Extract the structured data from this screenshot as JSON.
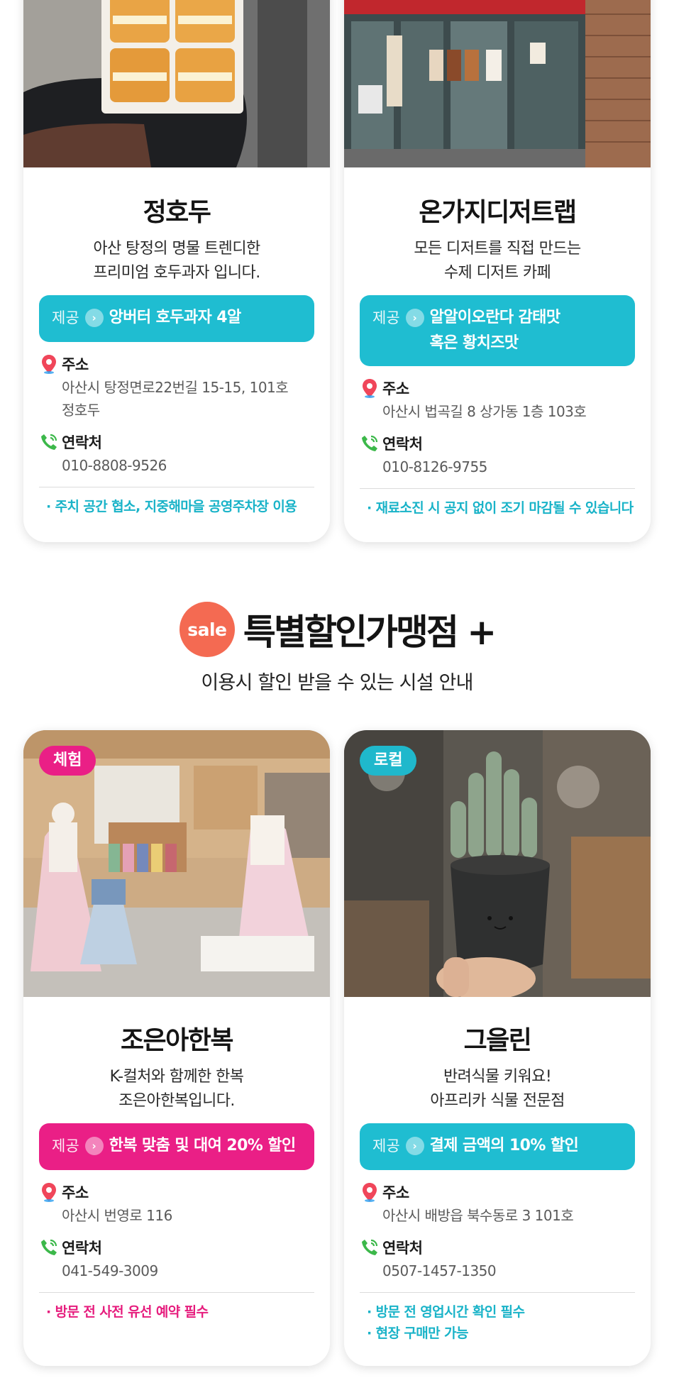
{
  "cards_top": [
    {
      "name": "정호두",
      "desc": [
        "아산 탕정의 명물 트렌디한",
        "프리미엄 호두과자 입니다."
      ],
      "benefit_label": "제공",
      "benefit": [
        "앙버터 호두과자 4알"
      ],
      "address_label": "주소",
      "address": [
        "아산시 탕정면로22번길 15-15, 101호",
        "정호두"
      ],
      "contact_label": "연락처",
      "phone": "010-8808-9526",
      "notes": [
        "· 주치 공간 협소, 지중해마을 공영주차장 이용"
      ]
    },
    {
      "name": "온가지디저트랩",
      "desc": [
        "모든 디저트를 직접 만드는",
        "수제 디저트 카페"
      ],
      "benefit_label": "제공",
      "benefit": [
        "알알이오란다 감태맛",
        "혹은 황치즈맛"
      ],
      "address_label": "주소",
      "address": [
        "아산시 법곡길 8 상가동 1층 103호"
      ],
      "contact_label": "연락처",
      "phone": "010-8126-9755",
      "notes": [
        "· 재료소진 시 공지 없이 조기 마감될 수 있습니다"
      ]
    }
  ],
  "section": {
    "badge": "sale",
    "title": "특별할인가맹점 +",
    "subtitle": "이용시 할인 받을 수 있는 시설 안내"
  },
  "cards_bottom": [
    {
      "tag": "체험",
      "name": "조은아한복",
      "desc": [
        "K-컬처와 함께한 한복",
        "조은아한복입니다."
      ],
      "benefit_label": "제공",
      "benefit": [
        "한복 맞춤 및 대여 20% 할인"
      ],
      "address_label": "주소",
      "address": [
        "아산시 번영로 116"
      ],
      "contact_label": "연락처",
      "phone": "041-549-3009",
      "notes": [
        "· 방문 전 사전 유선 예약 필수"
      ]
    },
    {
      "tag": "로컬",
      "name": "그을린",
      "desc": [
        "반려식물 키워요!",
        "아프리카 식물 전문점"
      ],
      "benefit_label": "제공",
      "benefit": [
        "결제 금액의 10% 할인"
      ],
      "address_label": "주소",
      "address": [
        "아산시 배방읍 북수동로 3 101호"
      ],
      "contact_label": "연락처",
      "phone": "0507-1457-1350",
      "notes": [
        "· 방문 전 영업시간 확인 필수",
        "· 현장 구매만 가능"
      ]
    }
  ],
  "icons": {
    "benefit_arrow": "chevron-right-icon",
    "address": "location-pin-icon",
    "contact": "phone-icon"
  },
  "colors": {
    "teal": "#1fbdd1",
    "pink": "#ea1f86",
    "sale": "#f46a52"
  }
}
